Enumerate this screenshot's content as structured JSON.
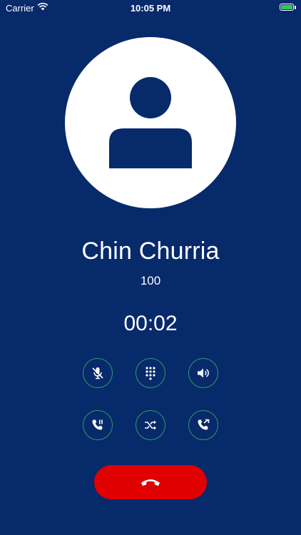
{
  "status_bar": {
    "carrier": "Carrier",
    "time": "10:05 PM"
  },
  "contact": {
    "name": "Chin Churria",
    "number": "100"
  },
  "call": {
    "duration": "00:02"
  },
  "controls": {
    "row1": [
      {
        "name": "mute",
        "icon": "mic-muted-icon"
      },
      {
        "name": "keypad",
        "icon": "dialpad-icon"
      },
      {
        "name": "speaker",
        "icon": "speaker-icon"
      }
    ],
    "row2": [
      {
        "name": "hold",
        "icon": "phone-pause-icon"
      },
      {
        "name": "transfer",
        "icon": "shuffle-icon"
      },
      {
        "name": "forward",
        "icon": "phone-forward-icon"
      }
    ]
  },
  "colors": {
    "background": "#072a6b",
    "control_border": "#2f9b67",
    "end_call": "#e00000",
    "battery": "#34c759"
  }
}
